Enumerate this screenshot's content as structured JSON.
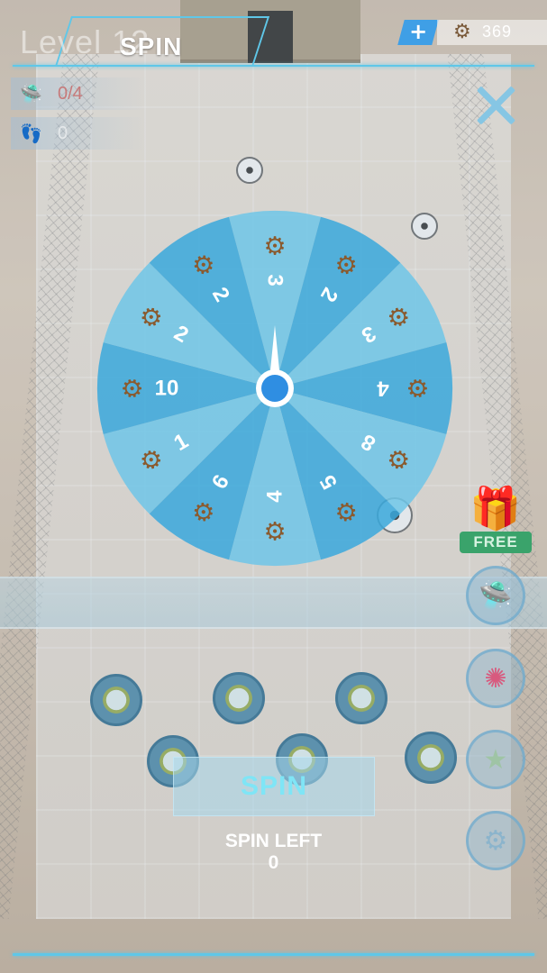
{
  "hud": {
    "level_text": "Level 12",
    "title": "SPIN",
    "currency": {
      "plus_icon": "plus-icon",
      "gear_icon": "gear-icon",
      "amount": "369"
    },
    "stats": [
      {
        "icon": "ufo-icon",
        "value": "0/4"
      },
      {
        "icon": "footprints-icon",
        "value": "0"
      }
    ],
    "close_icon": "close-icon"
  },
  "wheel": {
    "segments": [
      "3",
      "2",
      "3",
      "4",
      "8",
      "5",
      "4",
      "6",
      "1",
      "10",
      "2",
      "2"
    ],
    "segment_icon": "gear-icon",
    "colors": {
      "light": "#6fc6e8",
      "dark": "#3aa8dc",
      "center": "#2f8ee2"
    },
    "pointer_icon": "needle-icon"
  },
  "side_buttons": {
    "gift_icon": "gift-icon",
    "free_label": "FREE",
    "ufo_icon": "ufo-icon",
    "wheel_icon": "prize-wheel-icon",
    "star_icon": "star-icon",
    "settings_icon": "gear-icon"
  },
  "spin": {
    "button_label": "SPIN",
    "left_label": "SPIN LEFT",
    "left_count": "0"
  }
}
